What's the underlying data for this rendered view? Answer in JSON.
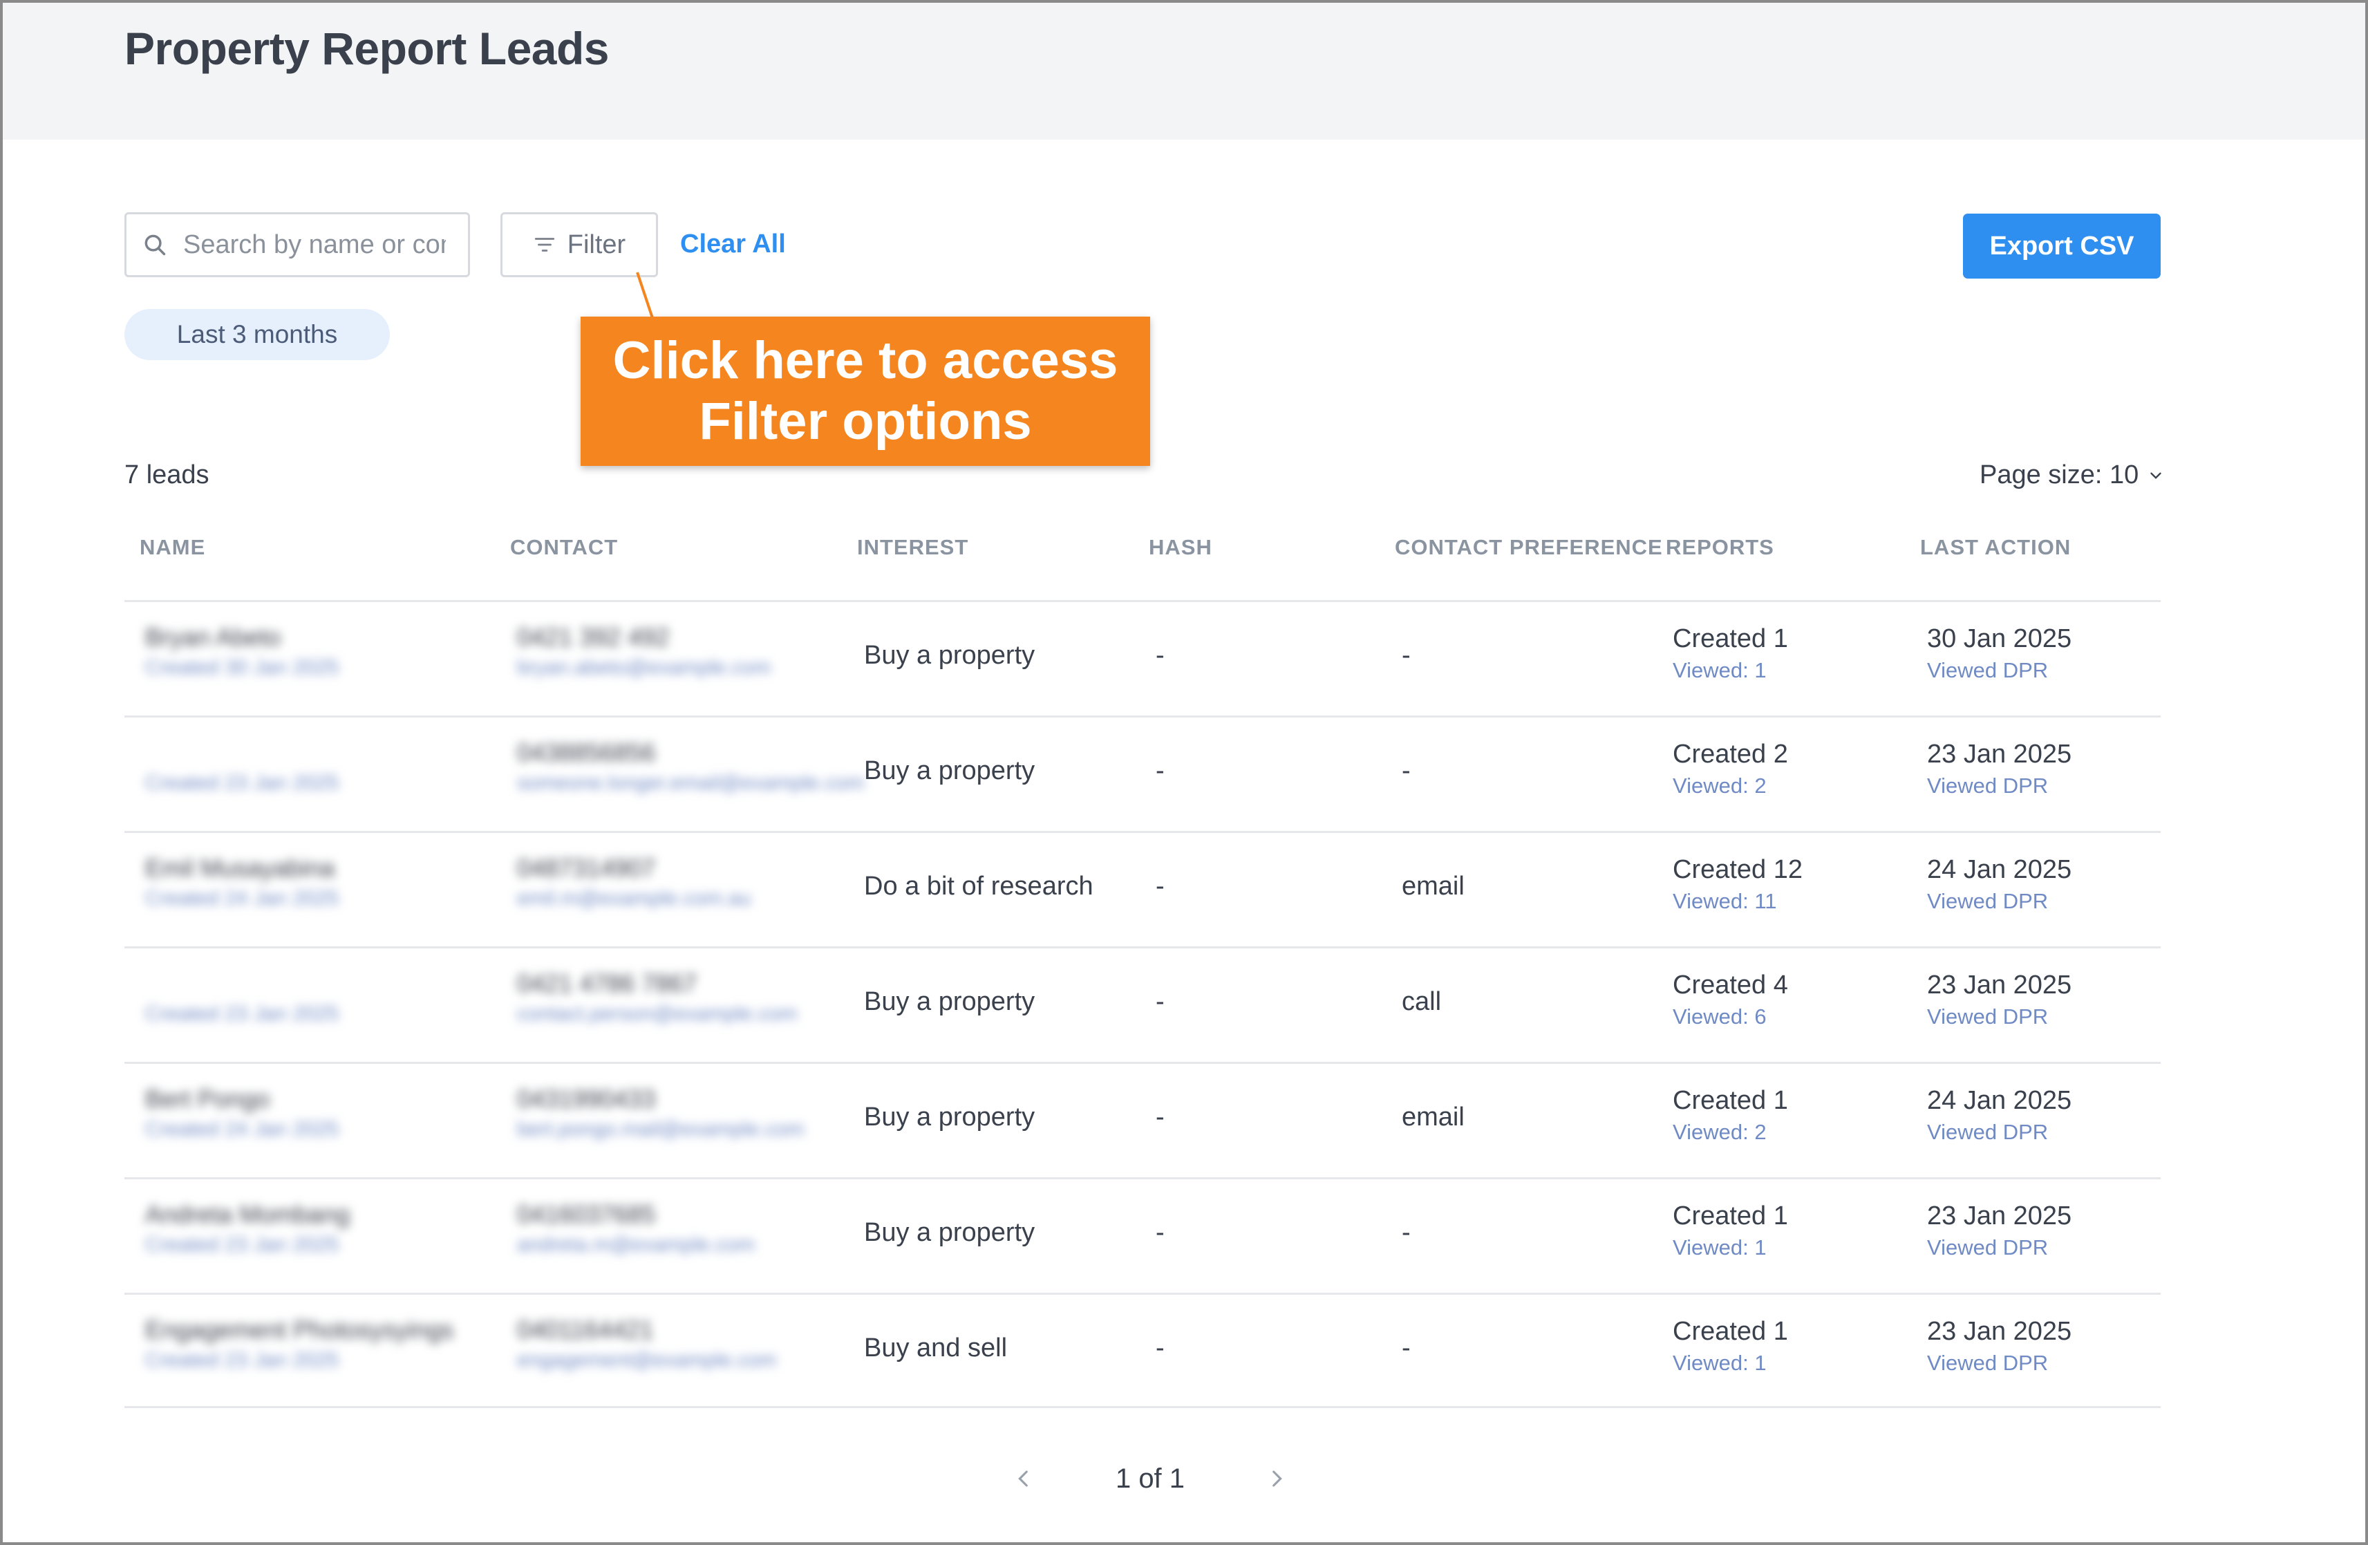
{
  "page": {
    "title": "Property Report Leads"
  },
  "toolbar": {
    "search_placeholder": "Search by name or contact",
    "filter_label": "Filter",
    "clear_all_label": "Clear All",
    "export_label": "Export CSV",
    "active_chip": "Last 3 months"
  },
  "callout": {
    "line1": "Click here to access",
    "line2": "Filter options",
    "color": "#f5851f"
  },
  "summary": {
    "leads_count": "7 leads",
    "page_size": "Page size: 10"
  },
  "table": {
    "columns": [
      "NAME",
      "CONTACT",
      "INTEREST",
      "HASH",
      "CONTACT PREFERENCE",
      "REPORTS",
      "LAST ACTION"
    ],
    "rows": [
      {
        "name": "Bryan Abeto",
        "name_sub": "Created 30 Jan 2025",
        "contact": "0421 392 492",
        "contact_sub": "bryan.abeto@example.com",
        "interest": "Buy a property",
        "hash": "-",
        "preference": "-",
        "reports": "Created 1",
        "reports_sub": "Viewed: 1",
        "last_action": "30 Jan 2025",
        "last_action_sub": "Viewed DPR"
      },
      {
        "name": "",
        "name_sub": "Created 23 Jan 2025",
        "contact": "0438856856",
        "contact_sub": "someone.longer.email@example.com",
        "interest": "Buy a property",
        "hash": "-",
        "preference": "-",
        "reports": "Created 2",
        "reports_sub": "Viewed: 2",
        "last_action": "23 Jan 2025",
        "last_action_sub": "Viewed DPR"
      },
      {
        "name": "Emil Musayabina",
        "name_sub": "Created 24 Jan 2025",
        "contact": "0487314907",
        "contact_sub": "emil.m@example.com.au",
        "interest": "Do a bit of research",
        "hash": "-",
        "preference": "email",
        "reports": "Created 12",
        "reports_sub": "Viewed: 11",
        "last_action": "24 Jan 2025",
        "last_action_sub": "Viewed DPR"
      },
      {
        "name": "",
        "name_sub": "Created 23 Jan 2025",
        "contact": "0421 4786 7867",
        "contact_sub": "contact.person@example.com",
        "interest": "Buy a property",
        "hash": "-",
        "preference": "call",
        "reports": "Created 4",
        "reports_sub": "Viewed: 6",
        "last_action": "23 Jan 2025",
        "last_action_sub": "Viewed DPR"
      },
      {
        "name": "Bert Pongo",
        "name_sub": "Created 24 Jan 2025",
        "contact": "0431990433",
        "contact_sub": "bert.pongo.mail@example.com",
        "interest": "Buy a property",
        "hash": "-",
        "preference": "email",
        "reports": "Created 1",
        "reports_sub": "Viewed: 2",
        "last_action": "24 Jan 2025",
        "last_action_sub": "Viewed DPR"
      },
      {
        "name": "Andreta Mombang",
        "name_sub": "Created 23 Jan 2025",
        "contact": "0416037685",
        "contact_sub": "andreta.m@example.com",
        "interest": "Buy a property",
        "hash": "-",
        "preference": "-",
        "reports": "Created 1",
        "reports_sub": "Viewed: 1",
        "last_action": "23 Jan 2025",
        "last_action_sub": "Viewed DPR"
      },
      {
        "name": "Engagement Photosysyings",
        "name_sub": "Created 23 Jan 2025",
        "contact": "0401164421",
        "contact_sub": "engagement@example.com",
        "interest": "Buy and sell",
        "hash": "-",
        "preference": "-",
        "reports": "Created 1",
        "reports_sub": "Viewed: 1",
        "last_action": "23 Jan 2025",
        "last_action_sub": "Viewed DPR"
      }
    ]
  },
  "pagination": {
    "label": "1 of 1"
  },
  "colors": {
    "accent": "#2f8ff0",
    "header_bg": "#f3f4f6",
    "chip_bg": "#e6effc",
    "sub_text": "#6f8ac4"
  },
  "icons": {
    "search": "search-icon",
    "filter": "filter-icon",
    "chevron_down": "chevron-down-icon",
    "prev": "chevron-left-icon",
    "next": "chevron-right-icon"
  }
}
